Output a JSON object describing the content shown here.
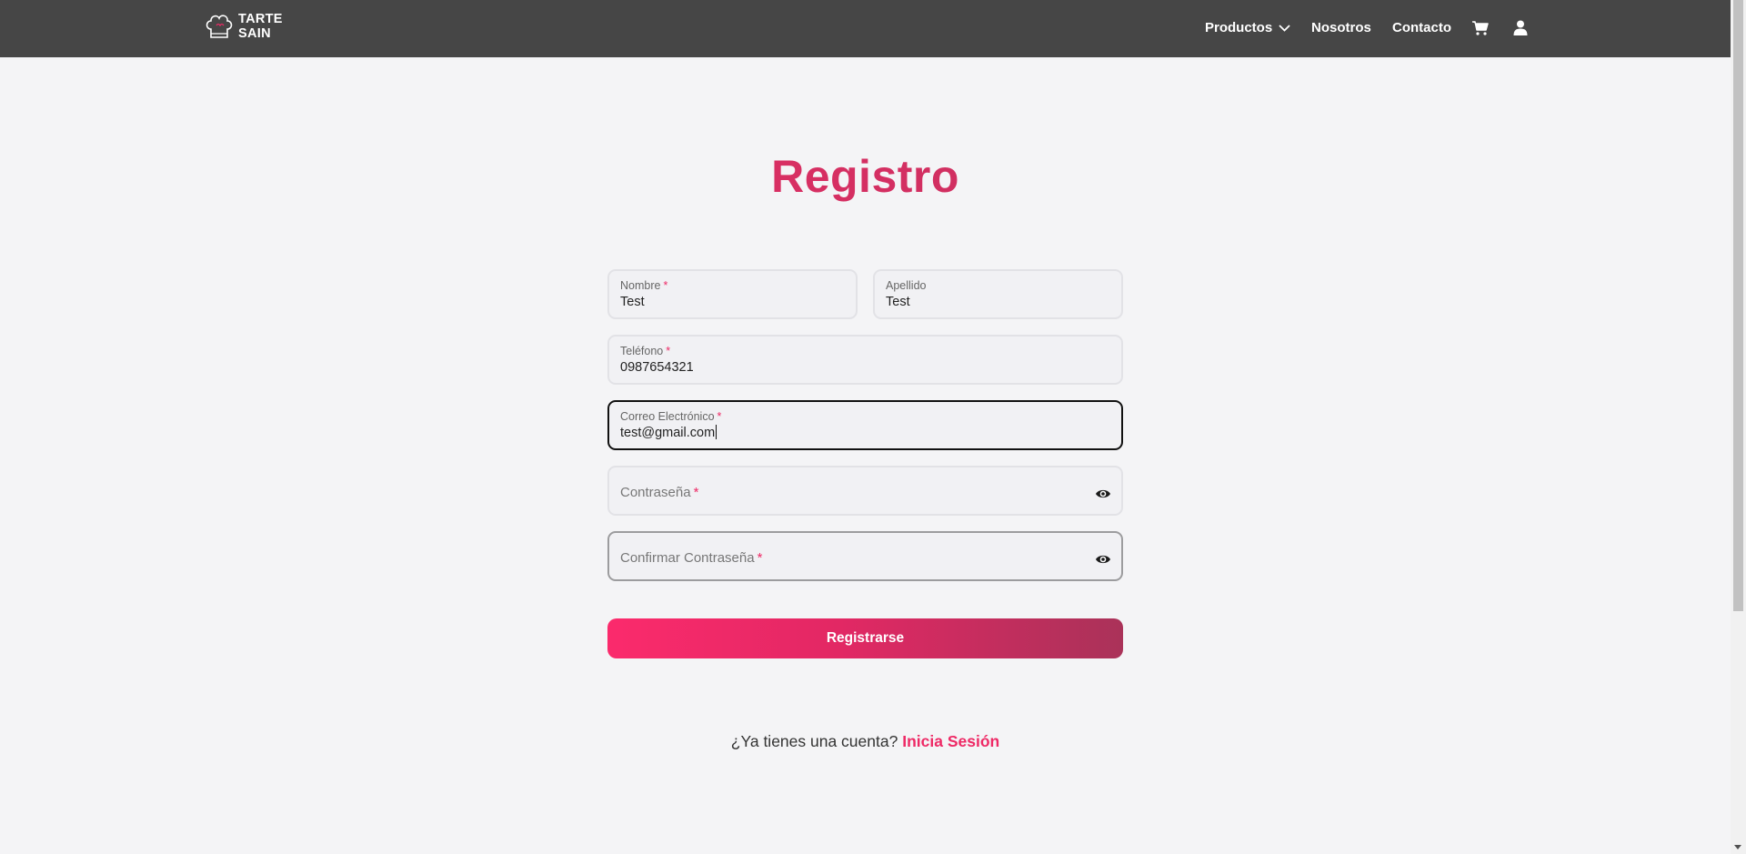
{
  "brand": {
    "line1": "TARTE",
    "line2": "SAIN"
  },
  "nav": {
    "products": "Productos",
    "about": "Nosotros",
    "contact": "Contacto"
  },
  "page": {
    "title": "Registro"
  },
  "form": {
    "nombre": {
      "label": "Nombre",
      "value": "Test"
    },
    "apellido": {
      "label": "Apellido",
      "value": "Test"
    },
    "telefono": {
      "label": "Teléfono",
      "value": "0987654321"
    },
    "correo": {
      "label": "Correo Electrónico",
      "value": "test@gmail.com"
    },
    "password": {
      "label": "Contraseña",
      "value": ""
    },
    "confirm": {
      "label": "Confirmar Contraseña",
      "value": ""
    },
    "required_marker": "*",
    "submit_label": "Registrarse"
  },
  "login_prompt": {
    "text": "¿Ya tienes una cuenta?",
    "link": "Inicia Sesión"
  },
  "colors": {
    "accent": "#ee2a66",
    "navbar": "#464646",
    "background": "#f4f4f6"
  }
}
